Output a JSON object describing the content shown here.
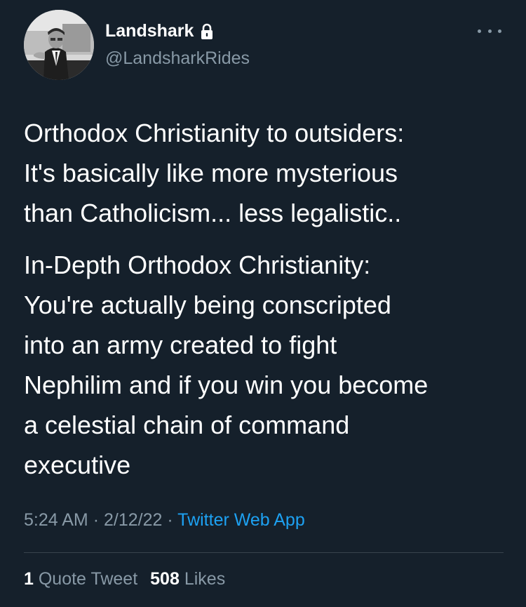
{
  "author": {
    "display_name": "Landshark",
    "handle": "@LandsharkRides",
    "protected_icon": "lock-icon",
    "avatar": "profile-photo-man-at-desk"
  },
  "menu_icon": "more-options-icon",
  "tweet": {
    "paragraphs": [
      [
        "Orthodox Christianity to outsiders:",
        "It's basically like more mysterious",
        "than Catholicism... less legalistic.."
      ],
      [
        "In-Depth Orthodox Christianity:",
        "You're actually being conscripted",
        "into an army created to fight",
        "Nephilim and if you win you become",
        "a celestial chain of command",
        "executive"
      ]
    ]
  },
  "meta": {
    "time": "5:24 AM",
    "separator": "·",
    "date": "2/12/22",
    "source": "Twitter Web App"
  },
  "stats": {
    "quote_count": "1",
    "quote_label": "Quote Tweet",
    "like_count": "508",
    "like_label": "Likes"
  },
  "colors": {
    "background": "#15202b",
    "text": "#ffffff",
    "secondary": "#8899a6",
    "link": "#1da1f2",
    "divider": "#38444d"
  }
}
